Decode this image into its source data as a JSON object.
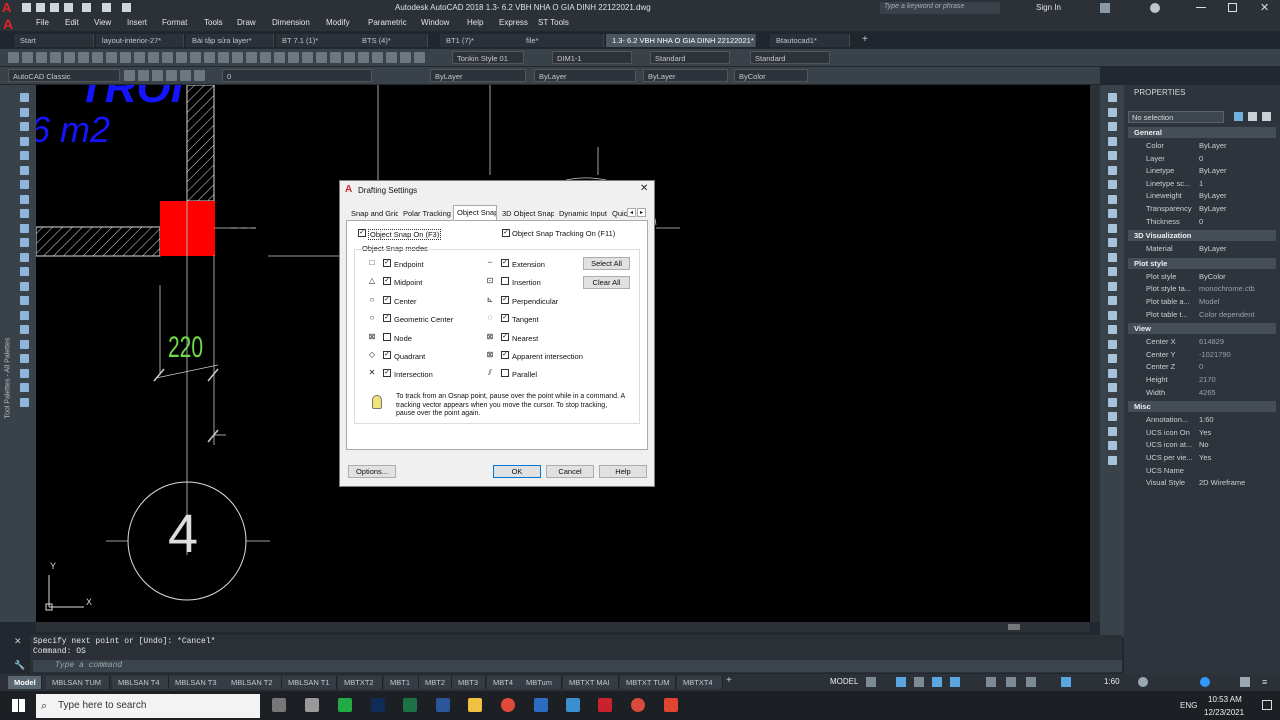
{
  "app": {
    "title": "Autodesk AutoCAD 2018   1.3- 6.2 VBH NHA O GIA DINH 22122021.dwg",
    "search_placeholder": "Type a keyword or phrase",
    "sign_in": "Sign In"
  },
  "menu": [
    "File",
    "Edit",
    "View",
    "Insert",
    "Format",
    "Tools",
    "Draw",
    "Dimension",
    "Modify",
    "Parametric",
    "Window",
    "Help",
    "Express",
    "ST Tools"
  ],
  "doc_tabs": [
    "Start",
    "layout-interior-27*",
    "Bài tập sửa layer*",
    "BT 7.1 (1)*",
    "BTS (4)*",
    "BT1 (7)*",
    "file*",
    "1.3- 6.2 VBH NHA O GIA DINH 22122021*",
    "Btautocad1*"
  ],
  "toolbar": {
    "text_style": "Tonkin Style 01",
    "dim_style": "DIM1-1",
    "table_style": "Standard",
    "multileader_style": "Standard",
    "workspace": "AutoCAD Classic",
    "layer_value": "0",
    "color": "ByLayer",
    "linetype": "ByLayer",
    "lineweight": "ByLayer",
    "plotstyle": "ByColor"
  },
  "left_palette_label": "Tool Palettes - All Palettes",
  "drawing": {
    "text_big": "TROI",
    "area_text": "6 m2",
    "dimension": "220",
    "grid_bubble": "4",
    "ucs_x": "X",
    "ucs_y": "Y"
  },
  "properties": {
    "title": "PROPERTIES",
    "selection": "No selection",
    "sections": [
      {
        "name": "General",
        "rows": [
          [
            "Color",
            "ByLayer"
          ],
          [
            "Layer",
            "0"
          ],
          [
            "Linetype",
            "ByLayer"
          ],
          [
            "Linetype sc...",
            "1"
          ],
          [
            "Lineweight",
            "ByLayer"
          ],
          [
            "Transparency",
            "ByLayer"
          ],
          [
            "Thickness",
            "0"
          ]
        ]
      },
      {
        "name": "3D Visualization",
        "rows": [
          [
            "Material",
            "ByLayer"
          ]
        ]
      },
      {
        "name": "Plot style",
        "rows": [
          [
            "Plot style",
            "ByColor"
          ],
          [
            "Plot style ta...",
            "monochrome.ctb"
          ],
          [
            "Plot table a...",
            "Model"
          ],
          [
            "Plot table t...",
            "Color dependent"
          ]
        ]
      },
      {
        "name": "View",
        "rows": [
          [
            "Center X",
            "614829"
          ],
          [
            "Center Y",
            "-1021790"
          ],
          [
            "Center Z",
            "0"
          ],
          [
            "Height",
            "2170"
          ],
          [
            "Width",
            "4265"
          ]
        ]
      },
      {
        "name": "Misc",
        "rows": [
          [
            "Annotation...",
            "1:60"
          ],
          [
            "UCS icon On",
            "Yes"
          ],
          [
            "UCS icon at...",
            "No"
          ],
          [
            "UCS per vie...",
            "Yes"
          ],
          [
            "UCS Name",
            ""
          ],
          [
            "Visual Style",
            "2D Wireframe"
          ]
        ]
      }
    ]
  },
  "command": {
    "line1": "Specify next point or [Undo]: *Cancel*",
    "line2": "Command: OS",
    "placeholder": "Type a command"
  },
  "layout_tabs": [
    "Model",
    "MBLSAN TUM",
    "MBLSAN T4",
    "MBLSAN T3",
    "MBLSAN T2",
    "MBLSAN T1",
    "MBTXT2",
    "MBT1",
    "MBT2",
    "MBT3",
    "MBT4",
    "MBTum",
    "MBTXT MAI",
    "MBTXT TUM",
    "MBTXT4"
  ],
  "status": {
    "model": "MODEL",
    "scale": "1:60"
  },
  "taskbar": {
    "search": "Type here to search",
    "lang": "ENG",
    "time": "10:53 AM",
    "date": "12/23/2021"
  },
  "dialog": {
    "title": "Drafting Settings",
    "tabs": [
      "Snap and Grid",
      "Polar Tracking",
      "Object Snap",
      "3D Object Snap",
      "Dynamic Input",
      "Quic"
    ],
    "osnap_on": "Object Snap On (F3)",
    "otrack_on": "Object Snap Tracking On (F11)",
    "group": "Object Snap modes",
    "left_modes": [
      [
        "Endpoint",
        true
      ],
      [
        "Midpoint",
        true
      ],
      [
        "Center",
        true
      ],
      [
        "Geometric Center",
        true
      ],
      [
        "Node",
        false
      ],
      [
        "Quadrant",
        true
      ],
      [
        "Intersection",
        true
      ]
    ],
    "right_modes": [
      [
        "Extension",
        true
      ],
      [
        "Insertion",
        false
      ],
      [
        "Perpendicular",
        true
      ],
      [
        "Tangent",
        true
      ],
      [
        "Nearest",
        true
      ],
      [
        "Apparent intersection",
        true
      ],
      [
        "Parallel",
        false
      ]
    ],
    "select_all": "Select All",
    "clear_all": "Clear All",
    "hint": "To track from an Osnap point, pause over the point while in a command.  A tracking vector appears when you move the cursor.  To stop tracking, pause over the point again.",
    "options": "Options...",
    "ok": "OK",
    "cancel": "Cancel",
    "help": "Help"
  }
}
